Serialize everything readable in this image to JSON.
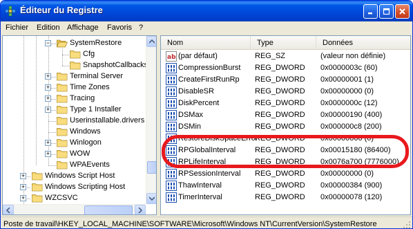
{
  "window": {
    "title": "Éditeur du Registre",
    "icon": "regedit-icon"
  },
  "menu": [
    "Fichier",
    "Edition",
    "Affichage",
    "Favoris",
    "?"
  ],
  "tree": {
    "items": [
      {
        "label": "SystemRestore",
        "expander": "-",
        "expanded": true
      },
      {
        "label": "Cfg",
        "expander": ""
      },
      {
        "label": "SnapshotCallbacks",
        "expander": ""
      },
      {
        "label": "Terminal Server",
        "expander": "+"
      },
      {
        "label": "Time Zones",
        "expander": "+"
      },
      {
        "label": "Tracing",
        "expander": "+"
      },
      {
        "label": "Type 1 Installer",
        "expander": "+"
      },
      {
        "label": "Userinstallable.drivers",
        "expander": ""
      },
      {
        "label": "Windows",
        "expander": ""
      },
      {
        "label": "Winlogon",
        "expander": "+"
      },
      {
        "label": "WOW",
        "expander": "+"
      },
      {
        "label": "WPAEvents",
        "expander": ""
      },
      {
        "label": "Windows Script Host",
        "expander": "+"
      },
      {
        "label": "Windows Scripting Host",
        "expander": "+"
      },
      {
        "label": "WZCSVC",
        "expander": "+"
      }
    ]
  },
  "list": {
    "columns": [
      "Nom",
      "Type",
      "Données"
    ],
    "rows": [
      {
        "name": "(par défaut)",
        "type": "REG_SZ",
        "data": "(valeur non définie)",
        "icon": "string-value-icon"
      },
      {
        "name": "CompressionBurst",
        "type": "REG_DWORD",
        "data": "0x0000003c (60)",
        "icon": "dword-value-icon"
      },
      {
        "name": "CreateFirstRunRp",
        "type": "REG_DWORD",
        "data": "0x00000001 (1)",
        "icon": "dword-value-icon"
      },
      {
        "name": "DisableSR",
        "type": "REG_DWORD",
        "data": "0x00000000 (0)",
        "icon": "dword-value-icon"
      },
      {
        "name": "DiskPercent",
        "type": "REG_DWORD",
        "data": "0x0000000c (12)",
        "icon": "dword-value-icon"
      },
      {
        "name": "DSMax",
        "type": "REG_DWORD",
        "data": "0x00000190 (400)",
        "icon": "dword-value-icon"
      },
      {
        "name": "DSMin",
        "type": "REG_DWORD",
        "data": "0x000000c8 (200)",
        "icon": "dword-value-icon"
      },
      {
        "name": "RestoreDiskSpaceError",
        "type": "REG_DWORD",
        "data": "0x00000000 (0)",
        "icon": "dword-value-icon"
      },
      {
        "name": "RPGlobalInterval",
        "type": "REG_DWORD",
        "data": "0x00015180 (86400)",
        "icon": "dword-value-icon"
      },
      {
        "name": "RPLifeInterval",
        "type": "REG_DWORD",
        "data": "0x0076a700 (7776000)",
        "icon": "dword-value-icon"
      },
      {
        "name": "RPSessionInterval",
        "type": "REG_DWORD",
        "data": "0x00000000 (0)",
        "icon": "dword-value-icon"
      },
      {
        "name": "ThawInterval",
        "type": "REG_DWORD",
        "data": "0x00000384 (900)",
        "icon": "dword-value-icon"
      },
      {
        "name": "TimerInterval",
        "type": "REG_DWORD",
        "data": "0x00000078 (120)",
        "icon": "dword-value-icon"
      }
    ]
  },
  "status": {
    "path": "Poste de travail\\HKEY_LOCAL_MACHINE\\SOFTWARE\\Microsoft\\Windows NT\\CurrentVersion\\SystemRestore"
  },
  "annotation": {
    "color": "#e8191d",
    "target": "RPGlobalInterval"
  }
}
